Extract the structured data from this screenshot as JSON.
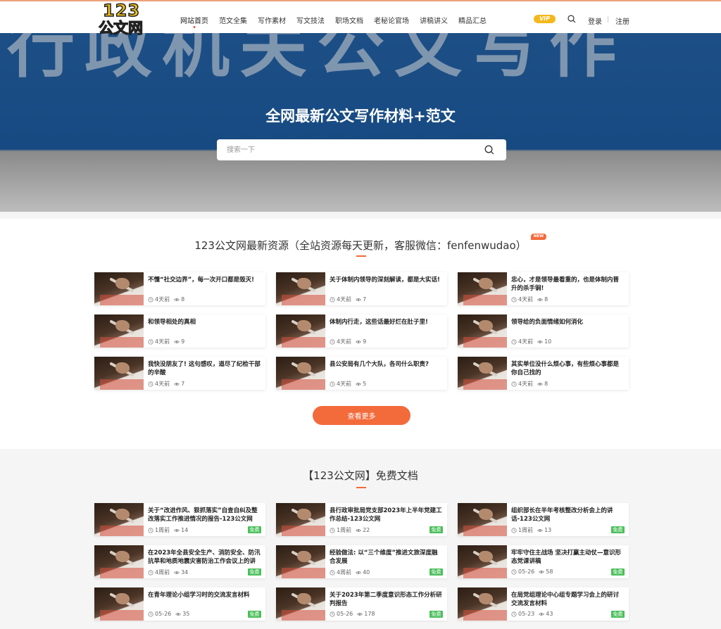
{
  "header": {
    "logo_number": "123",
    "logo_text": "公文网",
    "nav": [
      "网站首页",
      "范文全集",
      "写作素材",
      "写文技法",
      "职场文档",
      "老秘论官场",
      "讲稿讲义",
      "精品汇总"
    ],
    "vip_label": "VIP",
    "login": "登录",
    "separator": "|",
    "register": "注册"
  },
  "hero": {
    "background_text": "行政机关公文写作",
    "title": "全网最新公文写作材料+范文",
    "search_placeholder": "搜索一下"
  },
  "latest": {
    "title": "123公文网最新资源（全站资源每天更新，客服微信：fenfenwudao）",
    "badge": "NEW",
    "more_button": "查看更多",
    "items": [
      {
        "title": "不懂“社交边界”，每一次开口都是毁灭!",
        "time": "4天前",
        "views": "8"
      },
      {
        "title": "关于体制内领导的深刻解读，都是大实话!",
        "time": "4天前",
        "views": "7"
      },
      {
        "title": "忠心，才是领导最看重的，也是体制内晋升的杀手锏!",
        "time": "4天前",
        "views": "8"
      },
      {
        "title": "和领导相处的真相",
        "time": "4天前",
        "views": "9"
      },
      {
        "title": "体制内行走，这些话最好烂在肚子里!",
        "time": "4天前",
        "views": "9"
      },
      {
        "title": "领导给的负面情绪如何消化",
        "time": "4天前",
        "views": "10"
      },
      {
        "title": "我快没朋友了! 这句感叹，道尽了纪检干部的辛酸",
        "time": "4天前",
        "views": "7"
      },
      {
        "title": "县公安局有几个大队，各司什么职责?",
        "time": "4天前",
        "views": "5"
      },
      {
        "title": "其实单位没什么烦心事，有些烦心事都是你自己找的",
        "time": "4天前",
        "views": "8"
      }
    ]
  },
  "free_docs": {
    "title": "【123公文网】免费文档",
    "free_label": "免费",
    "items": [
      {
        "title": "关于“改进作风、狠抓落实”自查自纠及整改落实工作推进情况的报告-123公文网",
        "time": "1周前",
        "views": "14"
      },
      {
        "title": "县行政审批局党支部2023年上半年党建工作总结-123公文网",
        "time": "1周前",
        "views": "22"
      },
      {
        "title": "组织部长在半年考核整改分析会上的讲话-123公文网",
        "time": "1周前",
        "views": "13"
      },
      {
        "title": "在2023年全县安全生产、消防安全、防汛抗旱和地质地震灾害防治工作会议上的讲话",
        "time": "4周前",
        "views": "34"
      },
      {
        "title": "经验做法: 以“三个维度”推进文旅深度融合发展",
        "time": "4周前",
        "views": "40"
      },
      {
        "title": "牢牢守住主战场 坚决打赢主动仗—意识形态党课讲稿",
        "time": "05-26",
        "views": "58"
      },
      {
        "title": "在青年理论小组学习时的交流发言材料",
        "time": "05-26",
        "views": "35"
      },
      {
        "title": "关于2023年第二季度意识形态工作分析研判报告",
        "time": "05-26",
        "views": "178"
      },
      {
        "title": "在局党组理论中心组专题学习会上的研讨交流发言材料",
        "time": "05-23",
        "views": "43"
      }
    ]
  },
  "colors": {
    "accent": "#f36a3b",
    "hero_blue": "#174a82",
    "vip": "#f4b81d",
    "free_green": "#4bbf5a"
  },
  "icons": [
    "search-icon",
    "clock-icon",
    "eye-icon"
  ]
}
